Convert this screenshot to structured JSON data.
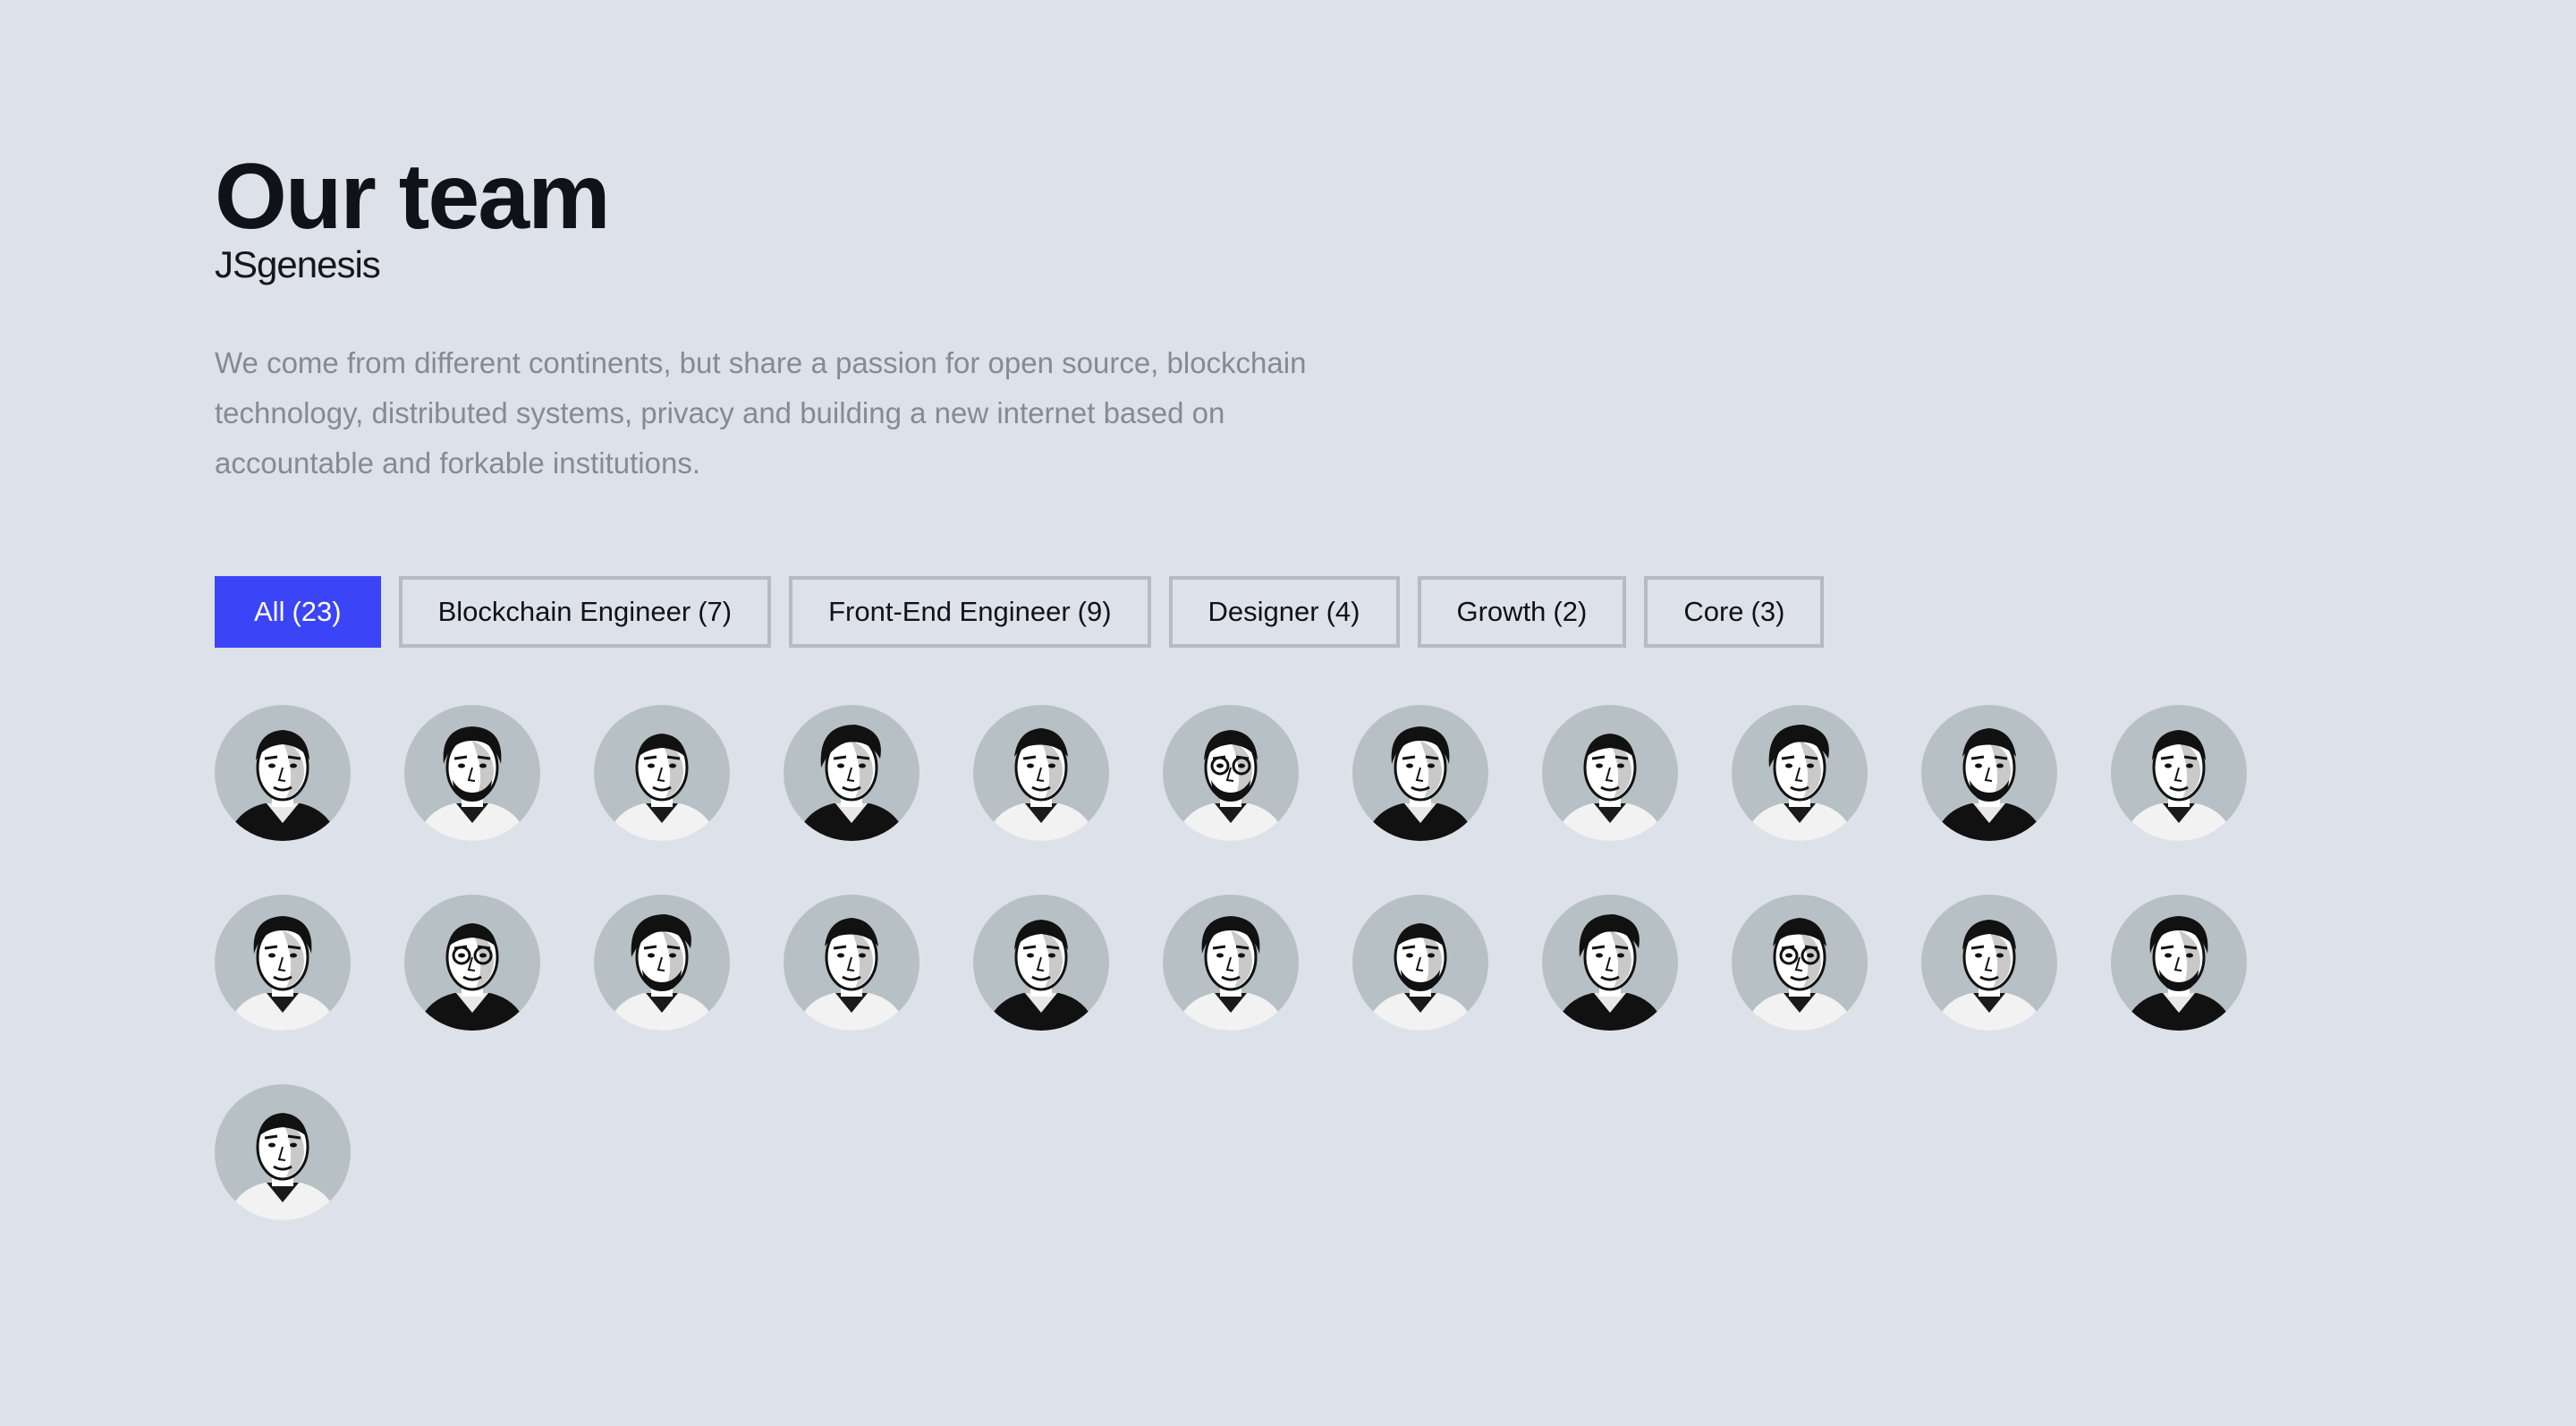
{
  "header": {
    "title": "Our team",
    "brand": "JSgenesis"
  },
  "intro": "We come from different continents, but share a passion for open source, blockchain technology, distributed systems, privacy and building a new internet based on accountable and forkable institutions.",
  "filters": [
    {
      "label": "All",
      "count": "(23)",
      "active": true
    },
    {
      "label": "Blockchain Engineer",
      "count": "(7)",
      "active": false
    },
    {
      "label": "Front-End Engineer",
      "count": "(9)",
      "active": false
    },
    {
      "label": "Designer",
      "count": "(4)",
      "active": false
    },
    {
      "label": "Growth",
      "count": "(2)",
      "active": false
    },
    {
      "label": "Core",
      "count": "(3)",
      "active": false
    }
  ],
  "colors": {
    "background": "#dde2ea",
    "accent": "#3b44f6",
    "avatar_bg": "#b7c0c4",
    "text_muted": "#858b94"
  },
  "team": {
    "member_count": 23,
    "avatar_style": "black-and-white portrait illustration on grey circle"
  }
}
